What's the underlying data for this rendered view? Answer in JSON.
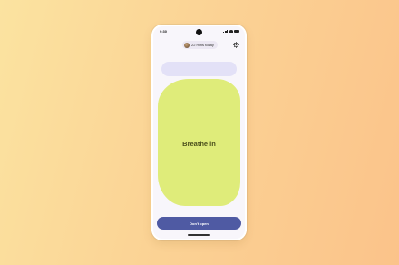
{
  "status_bar": {
    "time": "9:30"
  },
  "header": {
    "practice_pill": {
      "label": "22 mins today",
      "avatar": "user-avatar"
    },
    "settings_icon": "gear-icon"
  },
  "breathing": {
    "instruction": "Breathe in"
  },
  "footer": {
    "button_label": "Don't open"
  },
  "colors": {
    "background_start": "#fbe3a0",
    "background_end": "#fbc38a",
    "blob": "#dfec7a",
    "hint_bar": "#e3e1f7",
    "primary_button": "#4f5aa3",
    "screen": "#f8f6fb"
  }
}
